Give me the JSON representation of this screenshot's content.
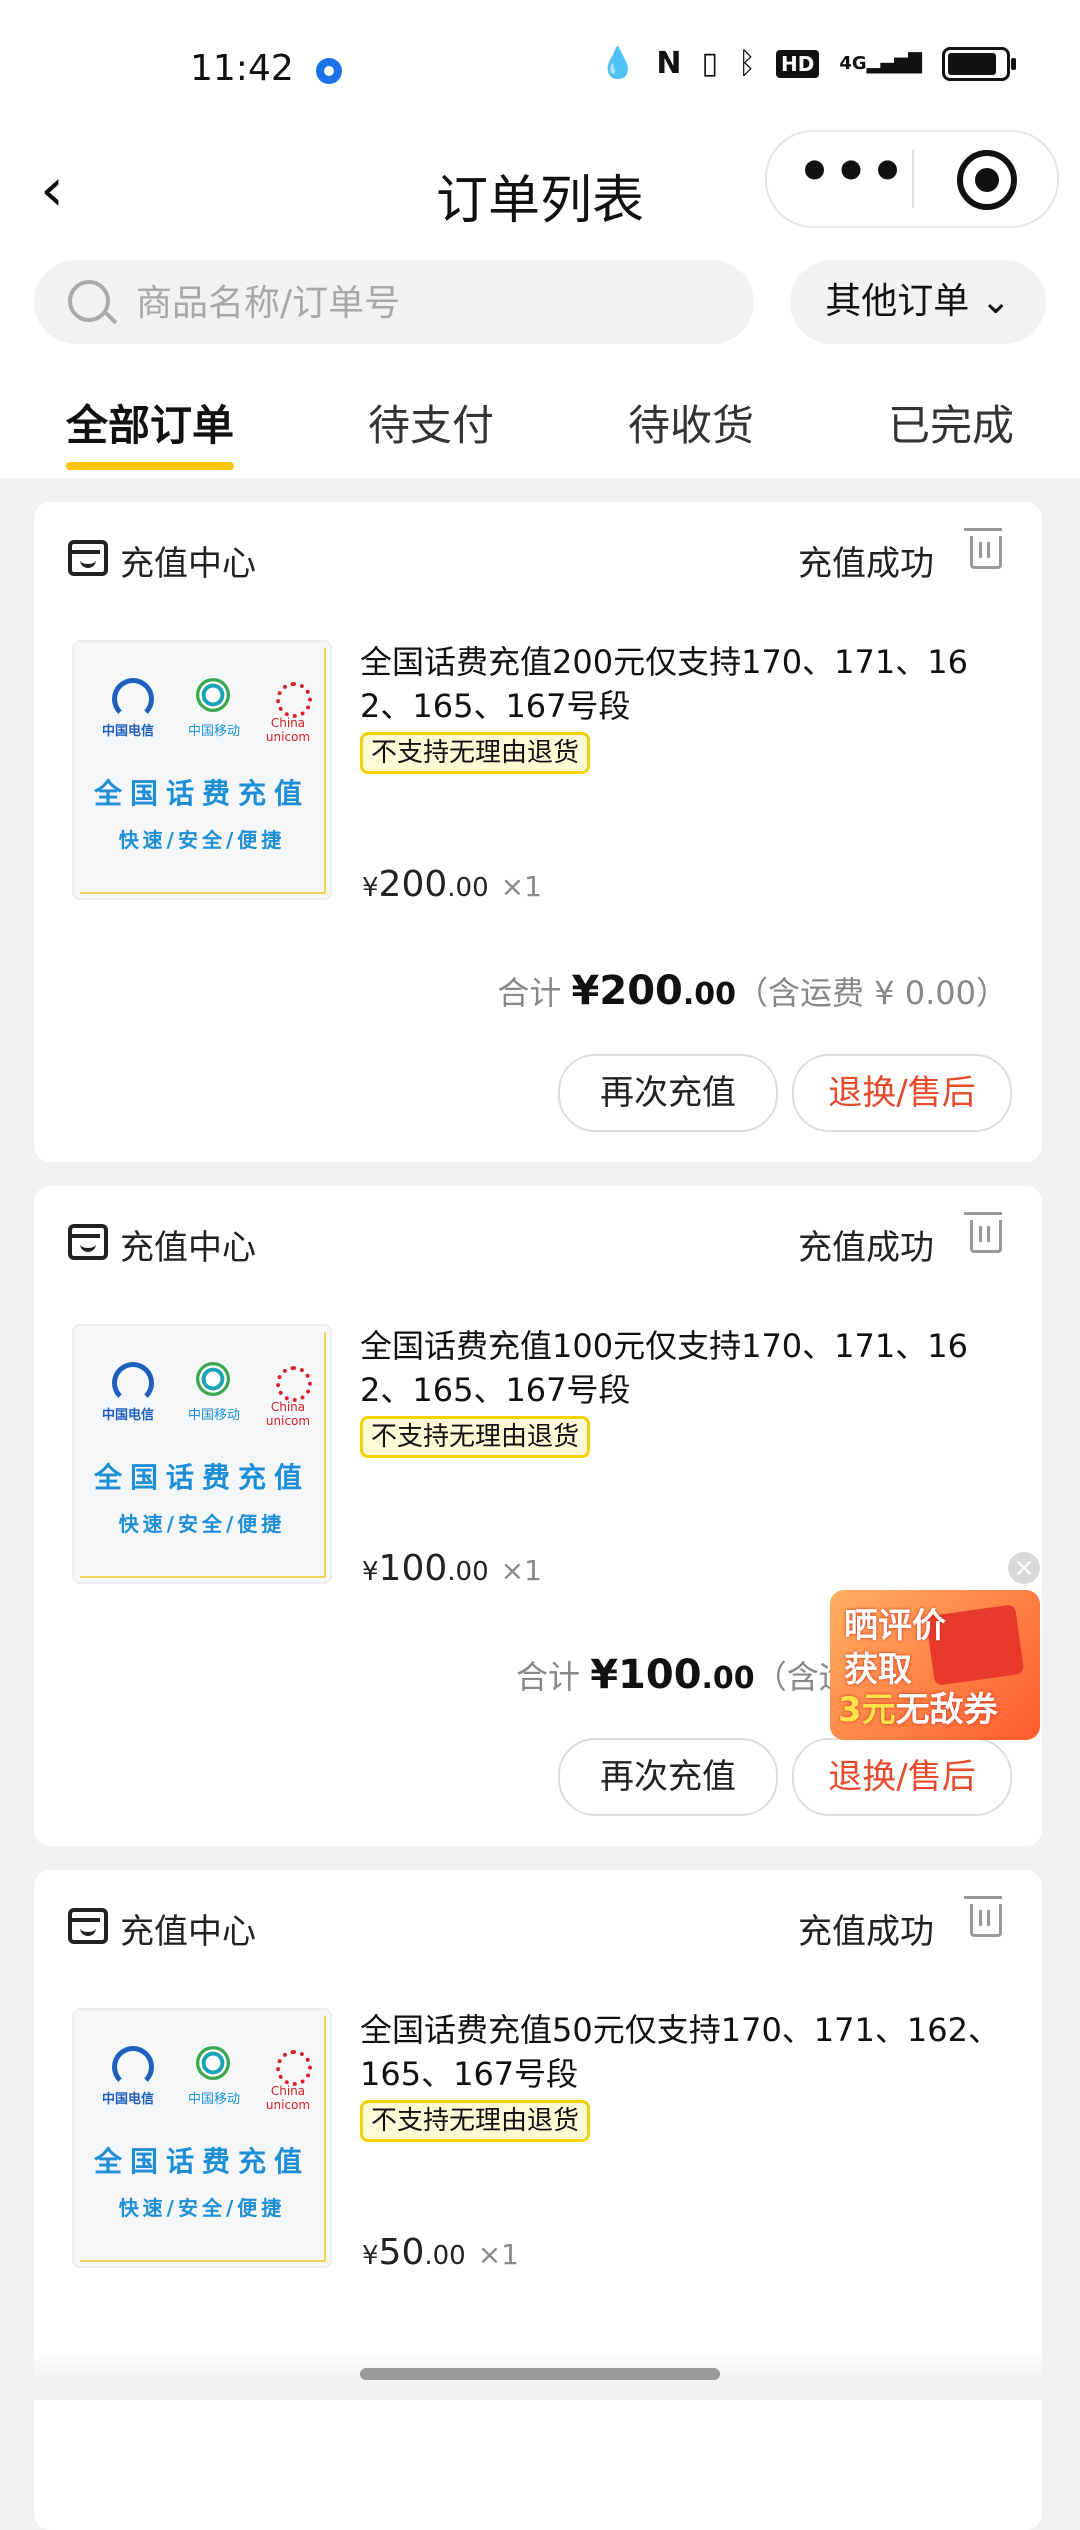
{
  "statusbar": {
    "time": "11:42",
    "icons": [
      "dot-icon",
      "nfc-icon",
      "vibrate-icon",
      "bluetooth-icon",
      "hd-icon",
      "signal-4g-icon",
      "battery-icon"
    ],
    "hd": "HD",
    "net": "4G"
  },
  "header": {
    "back_icon": "‹",
    "title": "订单列表",
    "more_icon": "•••"
  },
  "search": {
    "placeholder": "商品名称/订单号",
    "filter_label": "其他订单 ⌄"
  },
  "tabs": [
    {
      "label": "全部订单",
      "active": true
    },
    {
      "label": "待支付",
      "active": false
    },
    {
      "label": "待收货",
      "active": false
    },
    {
      "label": "已完成",
      "active": false
    }
  ],
  "thumb": {
    "telecom": "中国电信",
    "mobile": "中国移动",
    "unicom": "China unicom",
    "title": "全国话费充值",
    "subtitle": "快速/安全/便捷"
  },
  "orders": [
    {
      "shop": "充值中心",
      "status": "充值成功",
      "name": "全国话费充值200元仅支持170、171、162、165、167号段",
      "tag": "不支持无理由退货",
      "price_int": "200",
      "price_dec": ".00",
      "qty": "×1",
      "total_label": "合计",
      "total_int": "200",
      "total_dec": ".00",
      "shipping": "（含运费 ¥ 0.00）",
      "btn_recharge": "再次充值",
      "btn_after": "退换/售后"
    },
    {
      "shop": "充值中心",
      "status": "充值成功",
      "name": "全国话费充值100元仅支持170、171、162、165、167号段",
      "tag": "不支持无理由退货",
      "price_int": "100",
      "price_dec": ".00",
      "qty": "×1",
      "total_label": "合计",
      "total_int": "100",
      "total_dec": ".00",
      "shipping": "（含运",
      "btn_recharge": "再次充值",
      "btn_after": "退换/售后"
    },
    {
      "shop": "充值中心",
      "status": "充值成功",
      "name": "全国话费充值50元仅支持170、171、162、165、167号段",
      "tag": "不支持无理由退货",
      "price_int": "50",
      "price_dec": ".00",
      "qty": "×1"
    }
  ],
  "currency": "¥",
  "float_ad": {
    "line1": "晒评价",
    "line2": "获取",
    "line3_num": "3元",
    "line3_rest": "无敌券",
    "close": "×"
  },
  "colors": {
    "accent_yellow": "#f7c600",
    "after_sale_red": "#e84a2c",
    "tag_border": "#f5d100"
  }
}
